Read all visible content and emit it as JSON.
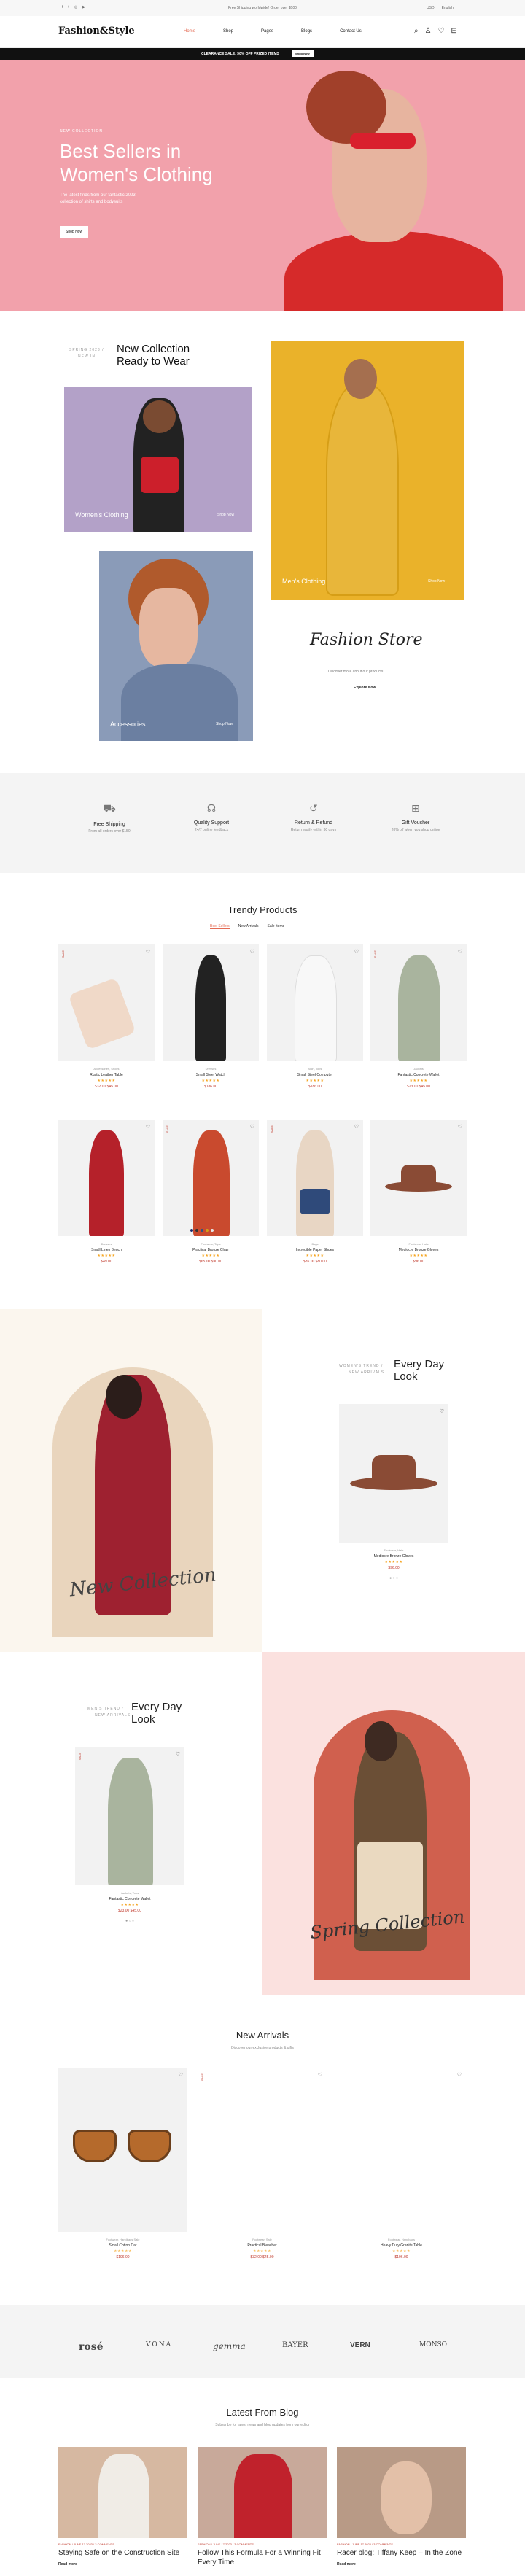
{
  "topbar": {
    "promo": "Free Shipping worldwide! Order over $100",
    "language": "USD",
    "currency": "English"
  },
  "header": {
    "logo": "Fashion&Style",
    "nav": [
      "Home",
      "Shop",
      "Pages",
      "Blogs",
      "Contact Us"
    ],
    "cart_count": "0",
    "wish_count": "0"
  },
  "promo_strip": {
    "text": "CLEARANCE SALE: 30% OFF PRIZED ITEMS",
    "button": "Shop Now"
  },
  "hero": {
    "eyebrow": "NEW COLLECTION",
    "title_line1": "Best Sellers in",
    "title_line2": "Women's Clothing",
    "sub_line1": "The latest finds from our fantastic 2023",
    "sub_line2": "collection of shirts and bodysuits",
    "button": "Shop Now"
  },
  "collection": {
    "eyebrow_line1": "SPRING 2023 /",
    "eyebrow_line2": "NEW IN",
    "title_line1": "New Collection",
    "title_line2": "Ready to Wear",
    "tiles": [
      {
        "label": "Women's Clothing",
        "link": "Shop Now"
      },
      {
        "label": "Men's Clothing",
        "link": "Shop Now"
      },
      {
        "label": "Accessories",
        "link": "Shop Now"
      }
    ],
    "store_title": "Fashion Store",
    "store_sub": "Discover more about our products",
    "store_link": "Explore Now"
  },
  "features": [
    {
      "title": "Free Shipping",
      "sub": "From all orders over $150"
    },
    {
      "title": "Quality Support",
      "sub": "24/7 online feedback"
    },
    {
      "title": "Return & Refund",
      "sub": "Return easily within 30 days"
    },
    {
      "title": "Gift Voucher",
      "sub": "20% off when you shop online"
    }
  ],
  "trendy": {
    "title": "Trendy Products",
    "tabs": [
      "Best Sellers",
      "New Arrivals",
      "Sale Items"
    ],
    "products": [
      {
        "cat": "Accessories, Shoes",
        "name": "Rustic Leather Table",
        "stars": "★★★★★",
        "price": "$32.00 $45.00",
        "badge": "SALE"
      },
      {
        "cat": "Dresses",
        "name": "Small Steel Watch",
        "stars": "★★★★★",
        "price": "$186.00",
        "badge": ""
      },
      {
        "cat": "Shirt, Tops",
        "name": "Small Steel Computer",
        "stars": "★★★★★",
        "price": "$186.00",
        "badge": ""
      },
      {
        "cat": "Jackets",
        "name": "Fantastic Concrete Wallet",
        "stars": "★★★★★",
        "price": "$23.00 $45.00",
        "badge": "SALE"
      },
      {
        "cat": "Dresses",
        "name": "Small Linen Bench",
        "stars": "★★★★★",
        "price": "$49.00",
        "badge": ""
      },
      {
        "cat": "Footwear, Tops",
        "name": "Practical Bronze Chair",
        "stars": "★★★★★",
        "price": "$65.00 $90.00",
        "badge": "SALE"
      },
      {
        "cat": "Bags",
        "name": "Incredible Paper Shoes",
        "stars": "★★★★★",
        "price": "$35.00 $80.00",
        "badge": "SALE"
      },
      {
        "cat": "Footwear, Hats",
        "name": "Mediocre Bronze Gloves",
        "stars": "★★★★★",
        "price": "$96.00",
        "badge": ""
      }
    ]
  },
  "everyday1": {
    "eyebrow_line1": "WOMEN'S TREND /",
    "eyebrow_line2": "NEW ARRIVALS",
    "title_line1": "Every Day",
    "title_line2": "Look",
    "collection_label": "New Collection",
    "product": {
      "cat": "Footwear, Hats",
      "name": "Mediocre Bronze Gloves",
      "stars": "★★★★★",
      "price": "$96.00"
    }
  },
  "everyday2": {
    "eyebrow_line1": "MEN'S TREND /",
    "eyebrow_line2": "NEW ARRIVALS",
    "title_line1": "Every Day",
    "title_line2": "Look",
    "collection_label": "Spring Collection",
    "product": {
      "cat": "Jackets, Tops",
      "name": "Fantastic Concrete Wallet",
      "stars": "★★★★★",
      "price": "$23.00 $45.00",
      "badge": "SALE"
    }
  },
  "arrivals": {
    "title": "New Arrivals",
    "sub": "Discover our exclusive products & gifts",
    "products": [
      {
        "cat": "Footwear, Handbags Sale",
        "name": "Small Cotton Car",
        "stars": "★★★★★",
        "price": "$196.00"
      },
      {
        "cat": "Footwear, Sale",
        "name": "Practical Bleacher",
        "stars": "★★★★★",
        "price": "$32.00 $45.00",
        "badge": "SALE"
      },
      {
        "cat": "Footwear, Handbags",
        "name": "Heavy Duty Granite Table",
        "stars": "★★★★★",
        "price": "$196.00"
      }
    ]
  },
  "brands": [
    "rosé",
    "VONA",
    "gemma",
    "BAYER",
    "VERN",
    "MONSO"
  ],
  "blog": {
    "title": "Latest From Blog",
    "sub": "Subscribe for latest news and blog updates from our editor",
    "posts": [
      {
        "meta": "FASHION / JUNE 17 2023 / 3 COMMENTS",
        "title_line1": "Staying Safe on the Construction Site",
        "link": "Read more"
      },
      {
        "meta": "FASHION / JUNE 17 2023 / 3 COMMENTS",
        "title_line1": "Follow This Formula For a Winning Fit",
        "title_line2": "Every Time",
        "link": "Read more"
      },
      {
        "meta": "FASHION / JUNE 17 2023 / 3 COMMENTS",
        "title_line1": "Racer blog: Tiffany Keep – In the Zone",
        "link": "Read more"
      }
    ]
  },
  "colors": {
    "accent": "#c0392b",
    "hero_bg": "#f2a1ab",
    "dark": "#111111"
  }
}
